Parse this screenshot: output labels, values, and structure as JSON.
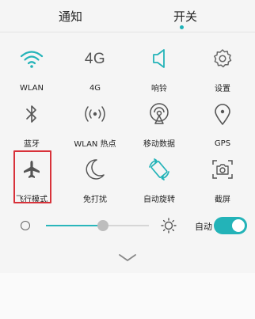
{
  "tabs": {
    "notify": "通知",
    "switch": "开关",
    "active": "开关"
  },
  "tiles": [
    {
      "label": "WLAN",
      "icon": "wifi-icon",
      "active": true
    },
    {
      "label": "4G",
      "icon_text": "4G",
      "icon": "mobile-network-4g-icon",
      "active": false
    },
    {
      "label": "响铃",
      "icon": "speaker-icon",
      "active": true
    },
    {
      "label": "设置",
      "icon": "gear-icon",
      "active": false
    },
    {
      "label": "蓝牙",
      "icon": "bluetooth-icon",
      "active": false
    },
    {
      "label": "WLAN 热点",
      "icon": "hotspot-icon",
      "active": false
    },
    {
      "label": "移动数据",
      "icon": "mobile-data-icon",
      "active": false
    },
    {
      "label": "GPS",
      "icon": "location-pin-icon",
      "active": false
    },
    {
      "label": "飞行模式",
      "icon": "airplane-icon",
      "active": false
    },
    {
      "label": "免打扰",
      "icon": "moon-icon",
      "active": false
    },
    {
      "label": "自动旋转",
      "icon": "auto-rotate-icon",
      "active": true
    },
    {
      "label": "截屏",
      "icon": "screenshot-icon",
      "active": false
    }
  ],
  "brightness": {
    "level": 0.55,
    "auto_label": "自动",
    "auto_on": true
  },
  "colors": {
    "accent": "#23b3b8",
    "highlight": "#d8323a"
  }
}
